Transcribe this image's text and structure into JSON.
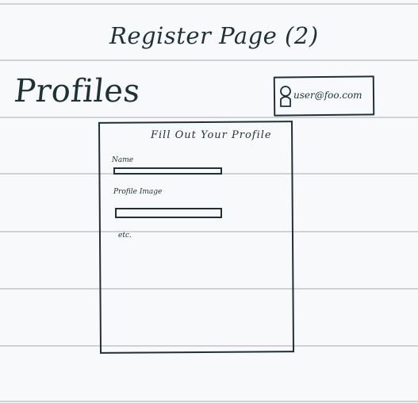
{
  "page": {
    "heading": "Register Page (2)"
  },
  "header": {
    "title": "Profiles",
    "user": {
      "email": "user@foo.com",
      "icon": "user-icon"
    }
  },
  "form": {
    "title": "Fill Out Your Profile",
    "fields": [
      {
        "label": "Name",
        "value": ""
      },
      {
        "label": "Profile Image",
        "value": ""
      }
    ],
    "more": "etc."
  },
  "colors": {
    "ink": "#1f3136",
    "paper": "#f8f9fa",
    "rule": "#cfd3d6"
  }
}
